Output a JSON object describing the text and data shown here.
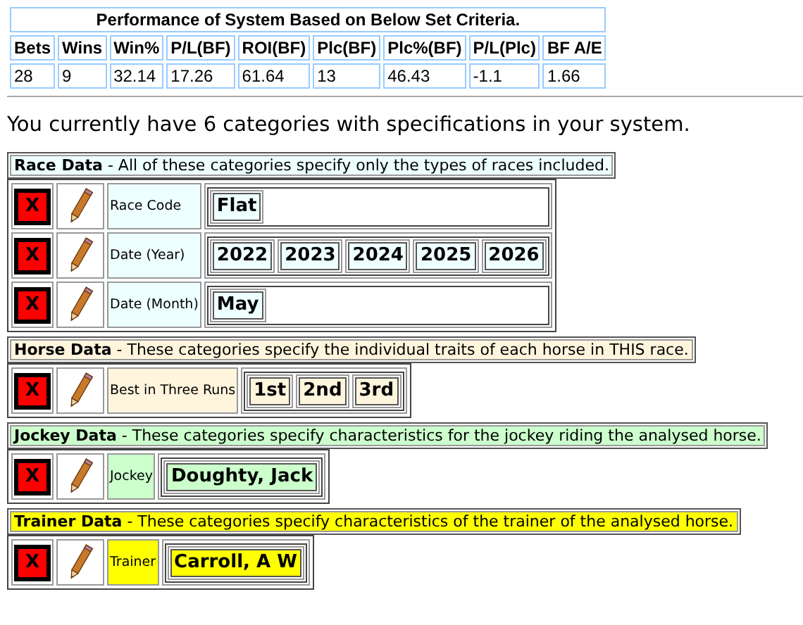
{
  "performance": {
    "title": "Performance of System Based on Below Set Criteria.",
    "columns": [
      "Bets",
      "Wins",
      "Win%",
      "P/L(BF)",
      "ROI(BF)",
      "Plc(BF)",
      "Plc%(BF)",
      "P/L(Plc)",
      "BF A/E"
    ],
    "values": [
      "28",
      "9",
      "32.14",
      "17.26",
      "61.64",
      "13",
      "46.43",
      "-1.1",
      "1.66"
    ]
  },
  "summary": "You currently have 6 categories with specifications in your system.",
  "sections": [
    {
      "title": "Race Data",
      "description": " - All of these categories specify only the types of races included.",
      "color": "#eeffff",
      "rows": [
        {
          "delete": "X",
          "label": "Race Code",
          "values": [
            "Flat"
          ]
        },
        {
          "delete": "X",
          "label": "Date (Year)",
          "values": [
            "2022",
            "2023",
            "2024",
            "2025",
            "2026"
          ]
        },
        {
          "delete": "X",
          "label": "Date (Month)",
          "values": [
            "May"
          ]
        }
      ]
    },
    {
      "title": "Horse Data",
      "description": " - These categories specify the individual traits of each horse in THIS race.",
      "color": "#fff5dd",
      "rows": [
        {
          "delete": "X",
          "label": "Best in Three Runs",
          "values": [
            "1st",
            "2nd",
            "3rd"
          ]
        }
      ]
    },
    {
      "title": "Jockey Data",
      "description": " - These categories specify characteristics for the jockey riding the analysed horse.",
      "color": "#ccffcc",
      "rows": [
        {
          "delete": "X",
          "label": "Jockey",
          "values": [
            "Doughty, Jack"
          ]
        }
      ]
    },
    {
      "title": "Trainer Data",
      "description": " - These categories specify characteristics of the trainer of the analysed horse.",
      "color": "#ffff00",
      "rows": [
        {
          "delete": "X",
          "label": "Trainer",
          "values": [
            "Carroll, A W"
          ]
        }
      ]
    }
  ]
}
